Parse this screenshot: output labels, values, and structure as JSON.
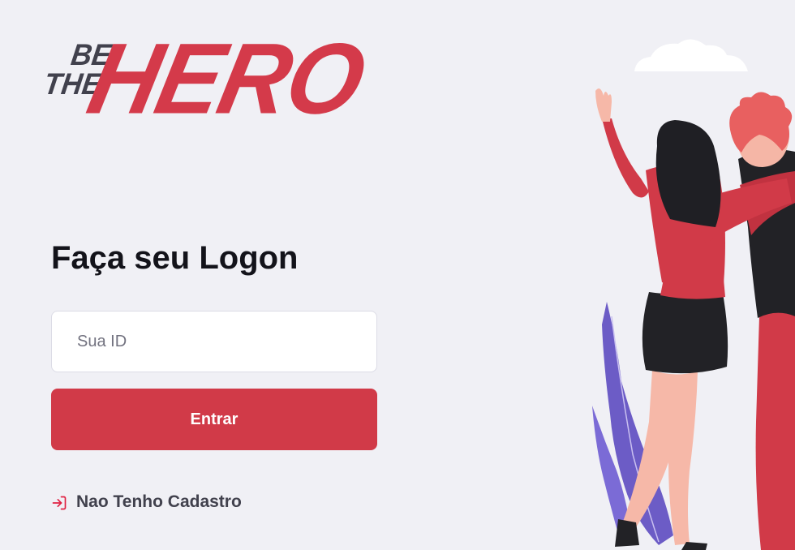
{
  "logo": {
    "be": "BE",
    "the": "THE",
    "hero": "HERO"
  },
  "form": {
    "title": "Faça seu Logon",
    "id_placeholder": "Sua ID",
    "submit_label": "Entrar",
    "register_label": "Nao Tenho Cadastro"
  },
  "icons": {
    "register": "log-in-icon"
  },
  "colors": {
    "background": "#f0f0f5",
    "brand_red": "#e02041",
    "button": "#d13a48",
    "text_dark": "#13131a",
    "text_muted": "#41414d"
  }
}
